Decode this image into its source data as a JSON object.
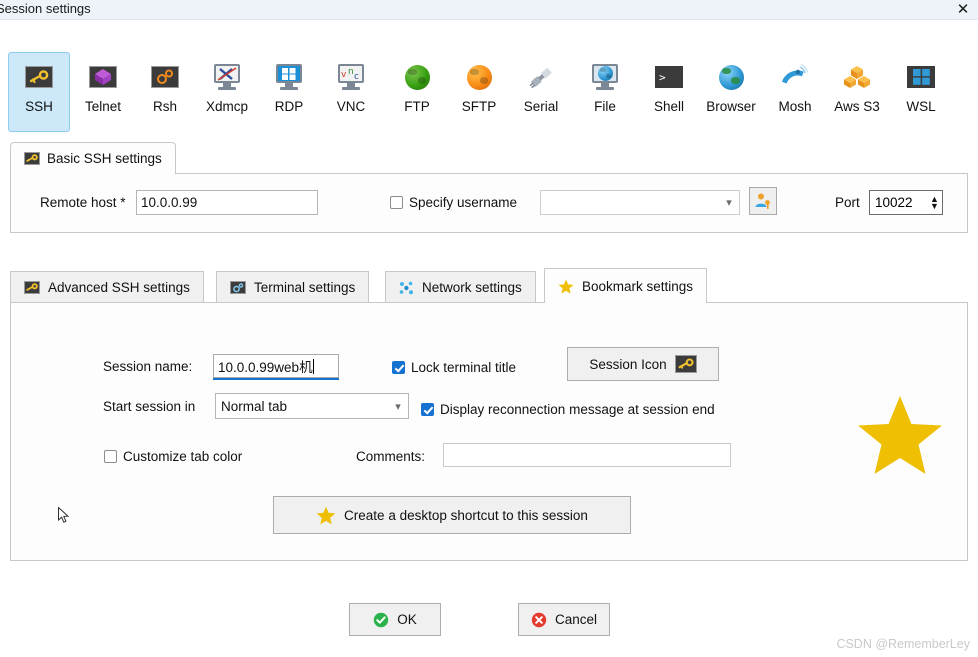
{
  "window": {
    "title": "Session settings",
    "close_label": "✕"
  },
  "session_types": [
    {
      "label": "SSH",
      "icon": "ssh-key-icon",
      "selected": true
    },
    {
      "label": "Telnet",
      "icon": "telnet-cube-icon",
      "selected": false
    },
    {
      "label": "Rsh",
      "icon": "rsh-gears-icon",
      "selected": false
    },
    {
      "label": "Xdmcp",
      "icon": "xdmcp-monitor-icon",
      "selected": false
    },
    {
      "label": "RDP",
      "icon": "rdp-monitor-icon",
      "selected": false
    },
    {
      "label": "VNC",
      "icon": "vnc-monitor-icon",
      "selected": false
    },
    {
      "label": "FTP",
      "icon": "ftp-globe-icon",
      "selected": false
    },
    {
      "label": "SFTP",
      "icon": "sftp-globe-icon",
      "selected": false
    },
    {
      "label": "Serial",
      "icon": "serial-plug-icon",
      "selected": false
    },
    {
      "label": "File",
      "icon": "file-monitor-icon",
      "selected": false
    },
    {
      "label": "Shell",
      "icon": "shell-prompt-icon",
      "selected": false
    },
    {
      "label": "Browser",
      "icon": "browser-globe-icon",
      "selected": false
    },
    {
      "label": "Mosh",
      "icon": "mosh-satellite-icon",
      "selected": false
    },
    {
      "label": "Aws S3",
      "icon": "aws-s3-cubes-icon",
      "selected": false
    },
    {
      "label": "WSL",
      "icon": "wsl-windows-icon",
      "selected": false
    }
  ],
  "basic_tab": {
    "label": "Basic SSH settings",
    "icon": "ssh-key-icon",
    "remote_host_label": "Remote host *",
    "remote_host_value": "10.0.0.99",
    "specify_username_label": "Specify username",
    "specify_username_checked": false,
    "username_value": "",
    "username_picker_icon": "user-key-icon",
    "port_label": "Port",
    "port_value": "10022"
  },
  "settings_tabs": [
    {
      "label": "Advanced SSH settings",
      "icon": "ssh-key-icon",
      "active": false
    },
    {
      "label": "Terminal settings",
      "icon": "terminal-gear-icon",
      "active": false
    },
    {
      "label": "Network settings",
      "icon": "network-dots-icon",
      "active": false
    },
    {
      "label": "Bookmark settings",
      "icon": "star-icon",
      "active": true
    }
  ],
  "bookmark": {
    "session_name_label": "Session name:",
    "session_name_value": "10.0.0.99web机",
    "lock_terminal_title_label": "Lock terminal title",
    "lock_terminal_title_checked": true,
    "session_icon_button_label": "Session Icon",
    "session_icon_glyph": "ssh-key-icon",
    "start_session_in_label": "Start session in",
    "start_session_in_value": "Normal tab",
    "display_reconnection_label": "Display reconnection message at session end",
    "display_reconnection_checked": true,
    "customize_tab_color_label": "Customize tab color",
    "customize_tab_color_checked": false,
    "comments_label": "Comments:",
    "comments_value": "",
    "shortcut_button_label": "Create a desktop shortcut to this session",
    "shortcut_button_icon": "star-icon"
  },
  "footer": {
    "ok_label": "OK",
    "ok_icon": "green-check-icon",
    "cancel_label": "Cancel",
    "cancel_icon": "red-x-icon"
  },
  "watermark": {
    "text": "CSDN @RememberLey"
  },
  "colors": {
    "accent_blue": "#1672d0",
    "selected_tile": "#cce8f9",
    "star_gold": "#efbf04",
    "ok_green": "#2bb24c",
    "cancel_red": "#e33b2e"
  }
}
